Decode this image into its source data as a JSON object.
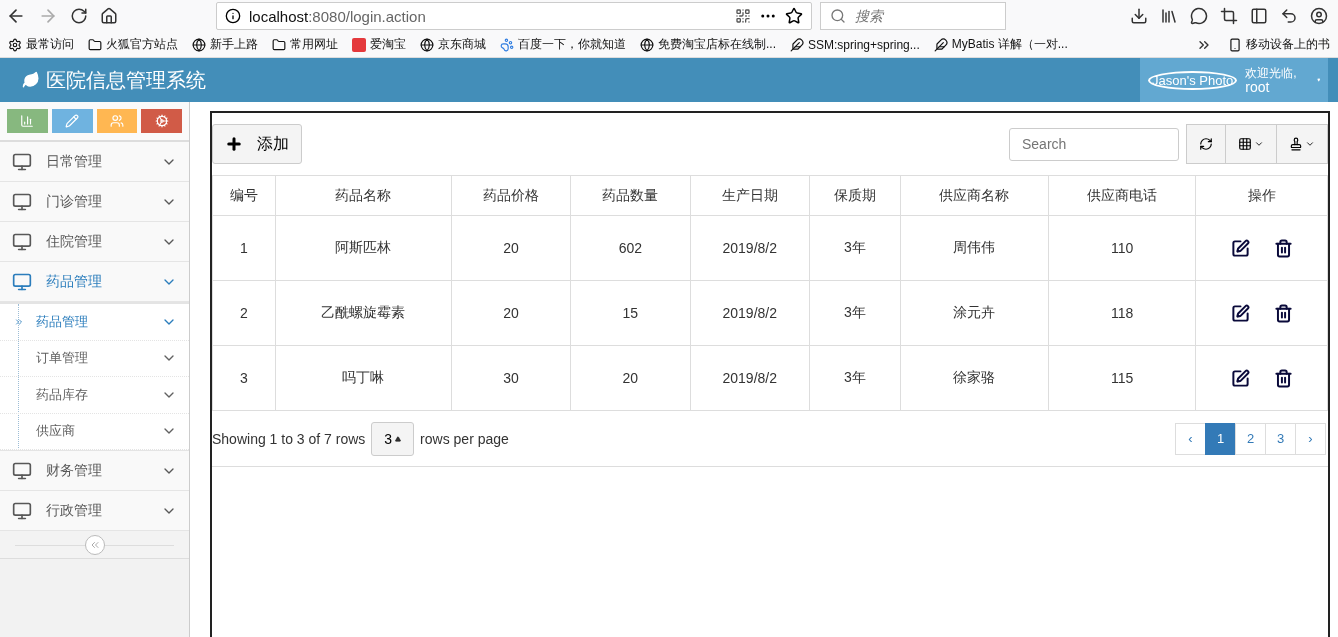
{
  "browser": {
    "url_host": "localhost",
    "url_rest": ":8080/login.action",
    "search_placeholder": "搜索",
    "bookmarks": [
      {
        "kind": "gear",
        "label": "最常访问"
      },
      {
        "kind": "folder",
        "label": "火狐官方站点"
      },
      {
        "kind": "globe",
        "label": "新手上路"
      },
      {
        "kind": "folder",
        "label": "常用网址"
      },
      {
        "kind": "shop",
        "label": "爱淘宝"
      },
      {
        "kind": "globe",
        "label": "京东商城"
      },
      {
        "kind": "paw",
        "label": "百度一下，你就知道"
      },
      {
        "kind": "globe",
        "label": "免费淘宝店标在线制..."
      },
      {
        "kind": "feather",
        "label": "SSM:spring+spring..."
      },
      {
        "kind": "feather",
        "label": "MyBatis 详解（一对..."
      }
    ],
    "mobile_bookmarks": "移动设备上的书"
  },
  "header": {
    "title": "医院信息管理系统",
    "photo_alt": "Jason's Photo",
    "welcome": "欢迎光临,",
    "user": "root"
  },
  "sidebar": {
    "shortcuts": [
      {
        "kind": "chart",
        "color": "#87b87f"
      },
      {
        "kind": "pencil",
        "color": "#6fb3e0"
      },
      {
        "kind": "users",
        "color": "#ffb752"
      },
      {
        "kind": "cogs",
        "color": "#d15b47"
      }
    ],
    "items": [
      {
        "label": "日常管理",
        "selected": false
      },
      {
        "label": "门诊管理",
        "selected": false
      },
      {
        "label": "住院管理",
        "selected": false
      },
      {
        "label": "药品管理",
        "selected": true,
        "children": [
          {
            "label": "药品管理",
            "selected": true
          },
          {
            "label": "订单管理",
            "selected": false
          },
          {
            "label": "药品库存",
            "selected": false
          },
          {
            "label": "供应商",
            "selected": false
          }
        ]
      },
      {
        "label": "财务管理",
        "selected": false
      },
      {
        "label": "行政管理",
        "selected": false
      }
    ]
  },
  "toolbar": {
    "add_label": "添加",
    "search_placeholder": "Search"
  },
  "table": {
    "columns": [
      "编号",
      "药品名称",
      "药品价格",
      "药品数量",
      "生产日期",
      "保质期",
      "供应商名称",
      "供应商电话",
      "操作"
    ],
    "rows": [
      [
        "1",
        "阿斯匹林",
        "20",
        "602",
        "2019/8/2",
        "3年",
        "周伟伟",
        "110"
      ],
      [
        "2",
        "乙酰螺旋霉素",
        "20",
        "15",
        "2019/8/2",
        "3年",
        "涂元卉",
        "118"
      ],
      [
        "3",
        "吗丁啉",
        "30",
        "20",
        "2019/8/2",
        "3年",
        "徐家骆",
        "115"
      ]
    ]
  },
  "pagination": {
    "summary": "Showing 1 to 3 of 7 rows",
    "page_size": "3",
    "per_page_label": "rows per page",
    "pages": [
      {
        "label": "‹",
        "selected": false
      },
      {
        "label": "1",
        "selected": true
      },
      {
        "label": "2",
        "selected": false
      },
      {
        "label": "3",
        "selected": false
      },
      {
        "label": "›",
        "selected": false
      }
    ]
  }
}
